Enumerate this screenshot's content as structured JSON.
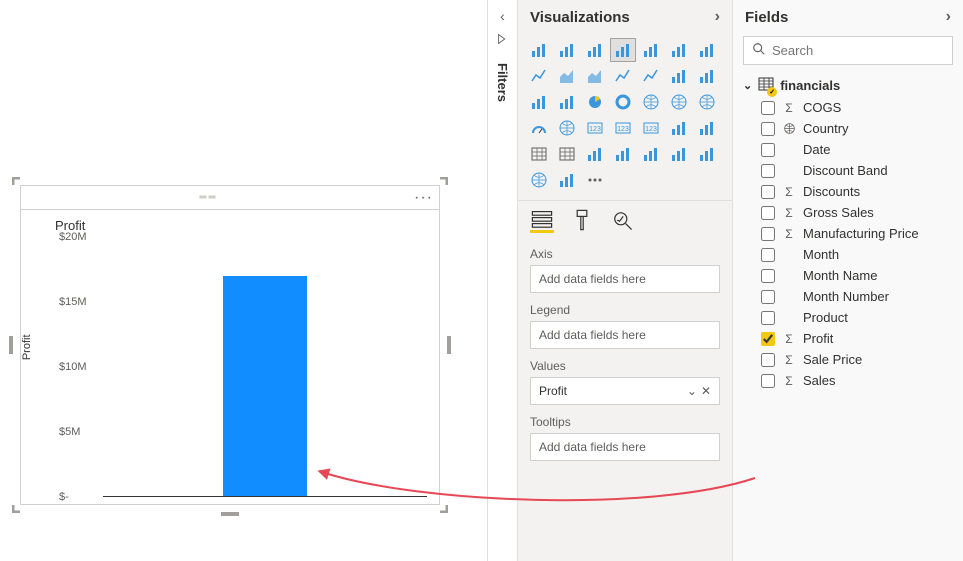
{
  "filters": {
    "label": "Filters"
  },
  "viz_panel": {
    "title": "Visualizations"
  },
  "wells": {
    "axis_label": "Axis",
    "axis_placeholder": "Add data fields here",
    "legend_label": "Legend",
    "legend_placeholder": "Add data fields here",
    "values_label": "Values",
    "values_value": "Profit",
    "tooltips_label": "Tooltips",
    "tooltips_placeholder": "Add data fields here"
  },
  "fields_panel": {
    "title": "Fields",
    "search_placeholder": "Search",
    "table": "financials"
  },
  "fields": [
    {
      "name": "COGS",
      "sigma": true,
      "checked": false,
      "icon": "sigma"
    },
    {
      "name": "Country",
      "sigma": false,
      "checked": false,
      "icon": "globe"
    },
    {
      "name": "Date",
      "sigma": false,
      "checked": false,
      "icon": "none"
    },
    {
      "name": "Discount Band",
      "sigma": false,
      "checked": false,
      "icon": "none"
    },
    {
      "name": "Discounts",
      "sigma": true,
      "checked": false,
      "icon": "sigma"
    },
    {
      "name": "Gross Sales",
      "sigma": true,
      "checked": false,
      "icon": "sigma"
    },
    {
      "name": "Manufacturing Price",
      "sigma": true,
      "checked": false,
      "icon": "sigma"
    },
    {
      "name": "Month",
      "sigma": false,
      "checked": false,
      "icon": "none"
    },
    {
      "name": "Month Name",
      "sigma": false,
      "checked": false,
      "icon": "none"
    },
    {
      "name": "Month Number",
      "sigma": false,
      "checked": false,
      "icon": "none"
    },
    {
      "name": "Product",
      "sigma": false,
      "checked": false,
      "icon": "none"
    },
    {
      "name": "Profit",
      "sigma": true,
      "checked": true,
      "icon": "sigma"
    },
    {
      "name": "Sale Price",
      "sigma": true,
      "checked": false,
      "icon": "sigma"
    },
    {
      "name": "Sales",
      "sigma": true,
      "checked": false,
      "icon": "sigma"
    }
  ],
  "visual": {
    "title": "Profit",
    "ylabel": "Profit"
  },
  "chart_data": {
    "type": "bar",
    "title": "Profit",
    "ylabel": "Profit",
    "xlabel": "",
    "categories": [
      ""
    ],
    "values": [
      17000000
    ],
    "ylim": [
      0,
      20000000
    ],
    "ticks": [
      {
        "v": 20000000,
        "label": "$20M"
      },
      {
        "v": 15000000,
        "label": "$15M"
      },
      {
        "v": 10000000,
        "label": "$10M"
      },
      {
        "v": 5000000,
        "label": "$5M"
      },
      {
        "v": 0,
        "label": "$-"
      }
    ]
  },
  "viz_icons": [
    "stacked-bar-icon",
    "column-chart-icon",
    "stacked-column-icon",
    "clustered-bar-icon",
    "clustered-column-icon",
    "hundred-bar-icon",
    "hundred-column-icon",
    "line-chart-icon",
    "area-chart-icon",
    "stacked-area-icon",
    "line-column-icon",
    "line-stacked-icon",
    "ribbon-icon",
    "waterfall-icon",
    "funnel-icon",
    "scatter-icon",
    "pie-icon",
    "donut-icon",
    "treemap-icon",
    "map-icon",
    "filled-map-icon",
    "gauge-icon",
    "shape-map-icon",
    "card-icon",
    "kpi-icon",
    "multi-card-icon",
    "slicer-icon",
    "key-influencer-icon",
    "table-icon",
    "matrix-icon",
    "r-visual-icon",
    "decomp-icon",
    "qna-icon",
    "paginated-icon",
    "smart-narrative-icon",
    "azure-map-icon",
    "py-visual-icon",
    "more-icon"
  ]
}
